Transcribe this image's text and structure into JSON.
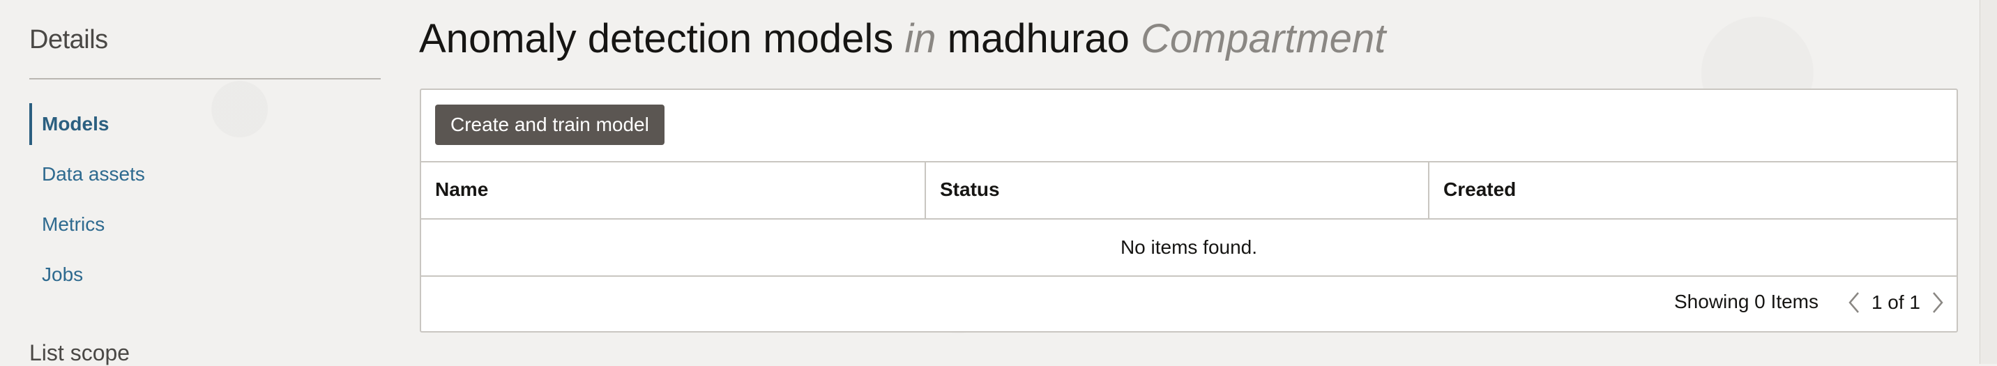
{
  "sidebar": {
    "heading": "Details",
    "items": [
      {
        "label": "Models",
        "active": true
      },
      {
        "label": "Data assets",
        "active": false
      },
      {
        "label": "Metrics",
        "active": false
      },
      {
        "label": "Jobs",
        "active": false
      }
    ],
    "list_scope": "List scope"
  },
  "header": {
    "title": "Anomaly detection models",
    "in_word": "in",
    "compartment_name": "madhurao",
    "compartment_word": "Compartment"
  },
  "toolbar": {
    "create_label": "Create and train model"
  },
  "table": {
    "columns": [
      "Name",
      "Status",
      "Created"
    ],
    "empty_text": "No items found."
  },
  "footer": {
    "showing": "Showing 0 Items",
    "page_indicator": "1 of 1"
  },
  "icons": {
    "prev": "chevron-left-icon",
    "next": "chevron-right-icon"
  },
  "colors": {
    "background": "#f2f1ef",
    "link": "#2e6a8f",
    "button": "#5b5652",
    "border": "#c9c6c1"
  }
}
